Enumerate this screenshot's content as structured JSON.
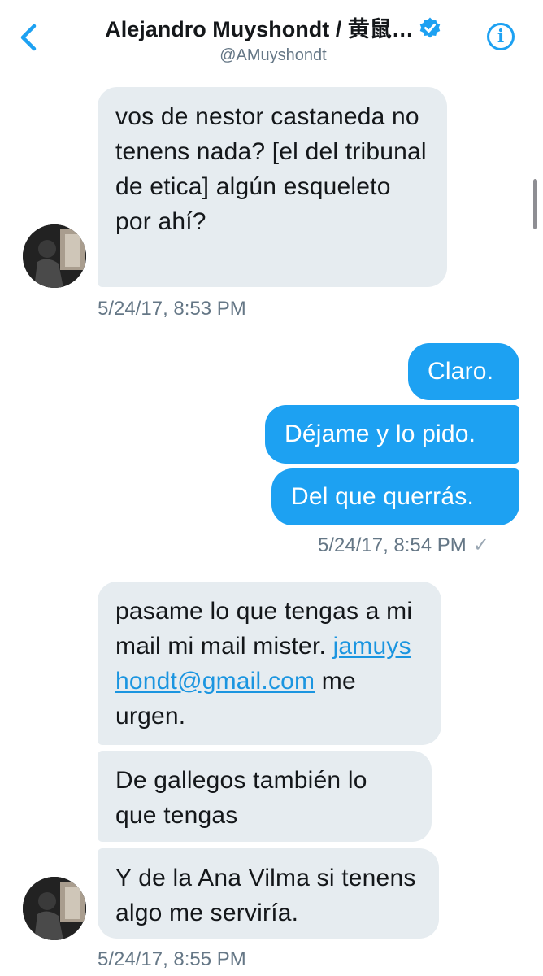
{
  "header": {
    "title": "Alejandro Muyshondt / 黄鼠…",
    "handle": "@AMuyshondt",
    "back_icon": "chevron-left-icon",
    "verified_icon": "verified-badge-icon",
    "info_icon": "info-icon",
    "info_glyph": "i",
    "accent": "#1da1f2"
  },
  "messages": {
    "m1": "vos de nestor castaneda no tenens nada? [el del tribunal de etica] algún esqueleto por ahí?",
    "ts1": "5/24/17, 8:53 PM",
    "m2": "Claro.",
    "m3": "Déjame y lo pido.",
    "m4": "Del que querrás.",
    "ts2": "5/24/17, 8:54 PM",
    "read_check": "✓",
    "m5_pre": "pasame lo que tengas a mi mail mi mail mister. ",
    "m5_link": "jamuyshondt@gmail.com",
    "m5_post": " me urgen.",
    "m6": "De gallegos también lo que tengas",
    "m7": "Y de la Ana Vilma si tenens algo me serviría.",
    "ts3": "5/24/17, 8:55 PM"
  },
  "colors": {
    "incoming_bubble": "#e6ecf0",
    "outgoing_bubble": "#1da1f2",
    "timestamp": "#657786"
  }
}
